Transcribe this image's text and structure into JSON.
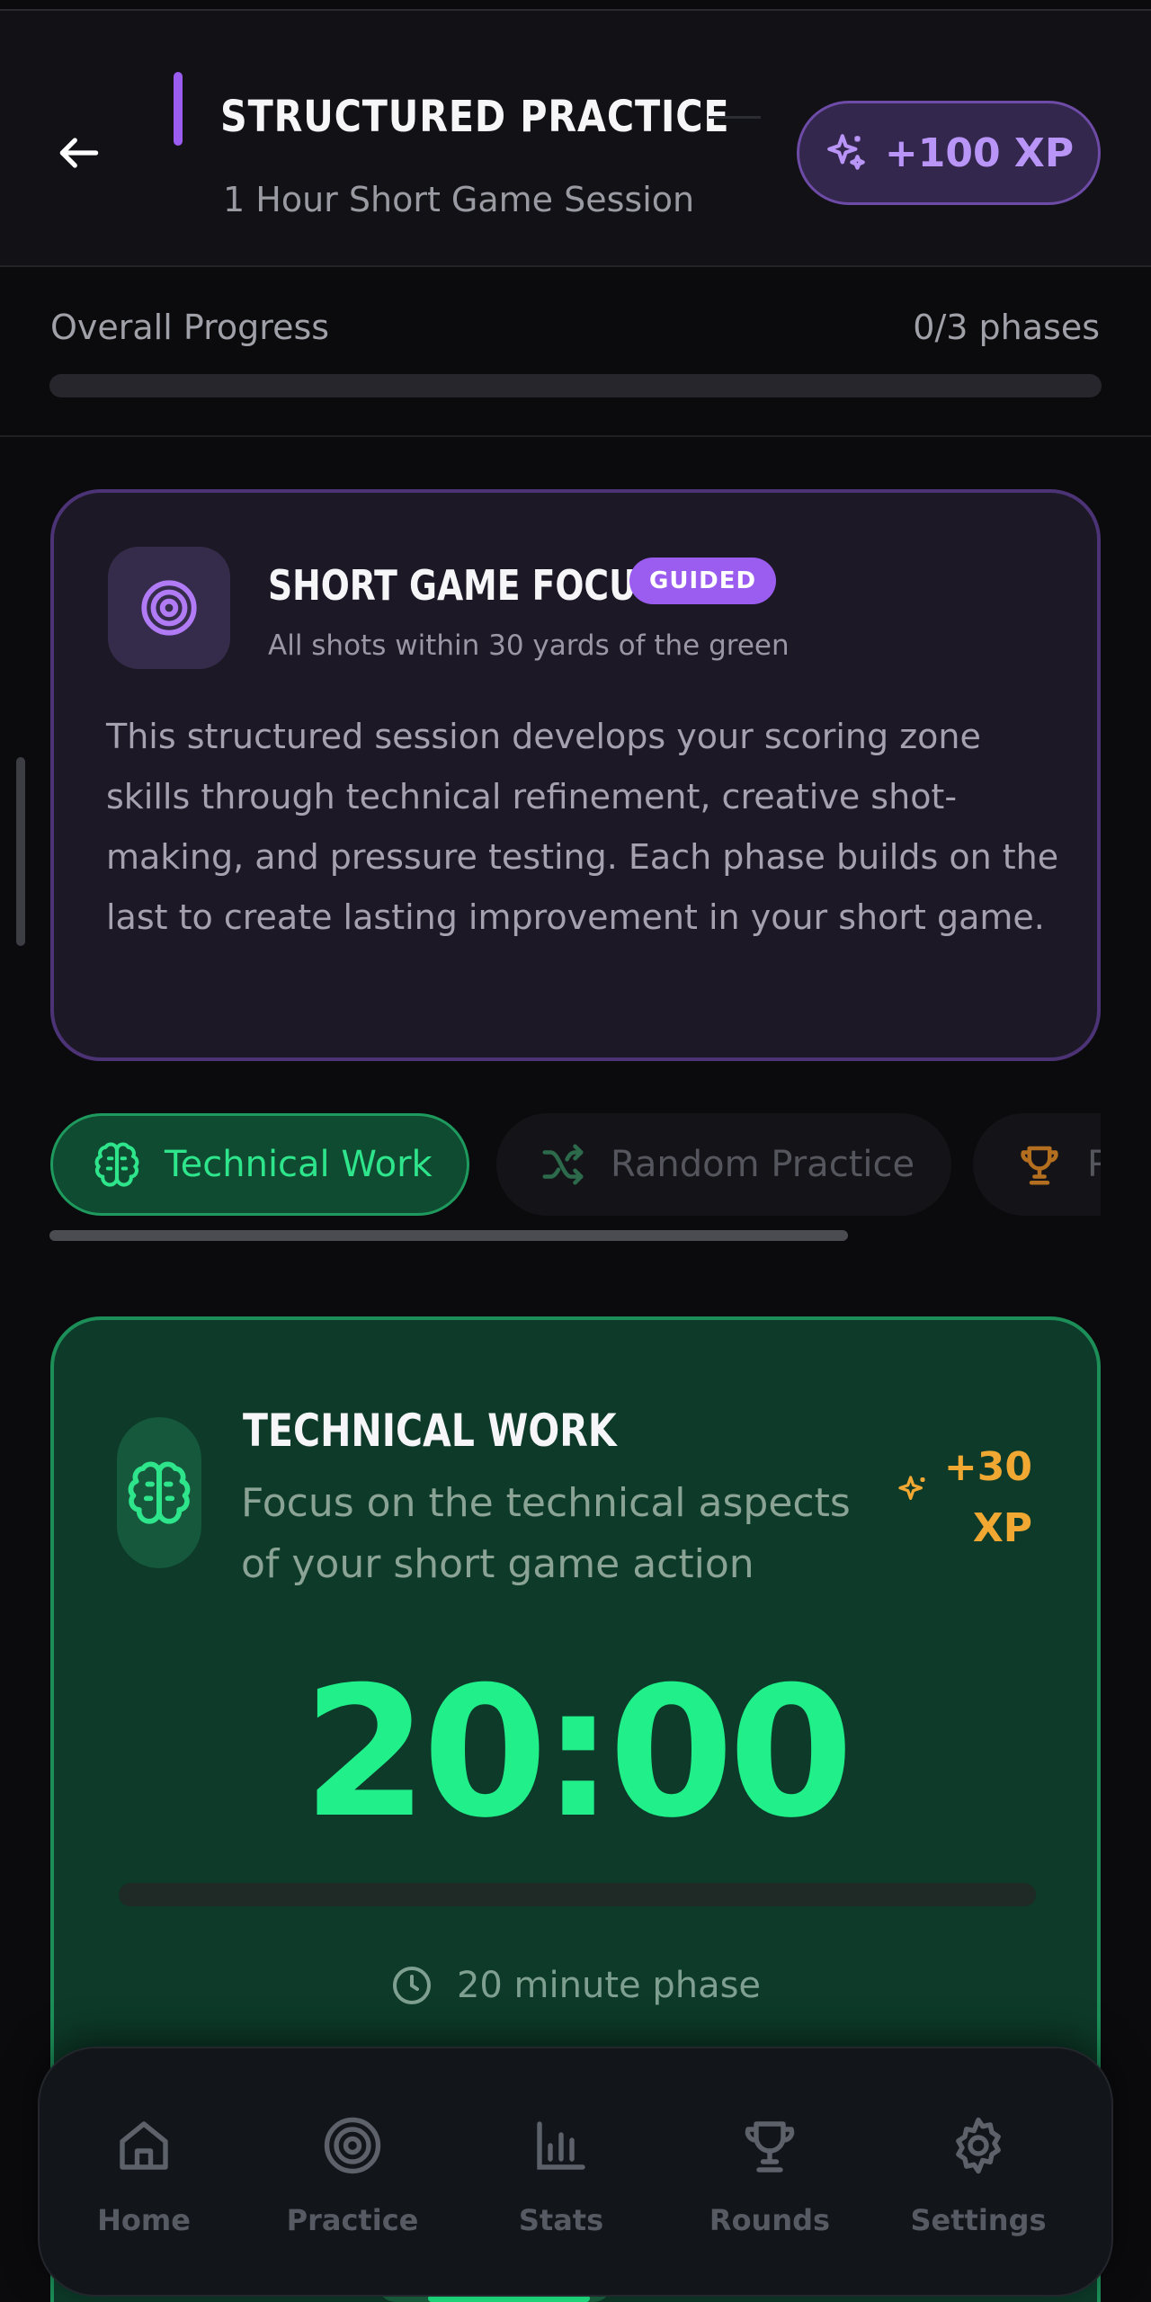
{
  "header": {
    "title": "STRUCTURED PRACTICE",
    "subtitle": "1 Hour Short Game Session",
    "xp_label": "+100 XP"
  },
  "progress": {
    "label": "Overall Progress",
    "count": "0/3 phases",
    "fraction": 0
  },
  "focus_card": {
    "title": "SHORT GAME FOCUS",
    "badge": "GUIDED",
    "subtitle": "All shots within 30 yards of the green",
    "description": "This structured session develops your scoring zone skills through technical refinement, creative shot-making, and pressure testing. Each phase builds on the last to create lasting improvement in your short game."
  },
  "tabs": [
    {
      "label": "Technical Work",
      "icon": "brain-icon",
      "active": true
    },
    {
      "label": "Random Practice",
      "icon": "shuffle-icon",
      "active": false
    },
    {
      "label": "P",
      "icon": "trophy-icon",
      "active": false
    }
  ],
  "phase": {
    "title": "TECHNICAL WORK",
    "description": "Focus on the technical aspects of your short game action",
    "xp_line1": "+30",
    "xp_line2": "XP",
    "timer": "20:00",
    "timer_fraction": 0,
    "duration": "20 minute phase"
  },
  "nav": [
    {
      "label": "Home",
      "icon": "home-icon"
    },
    {
      "label": "Practice",
      "icon": "target-icon"
    },
    {
      "label": "Stats",
      "icon": "bar-chart-icon"
    },
    {
      "label": "Rounds",
      "icon": "trophy-icon"
    },
    {
      "label": "Settings",
      "icon": "gear-icon"
    }
  ],
  "colors": {
    "accent_purple": "#9b5cf0",
    "accent_green": "#20ef8a",
    "xp_gold": "#f0a832",
    "background": "#0b0b0e"
  }
}
